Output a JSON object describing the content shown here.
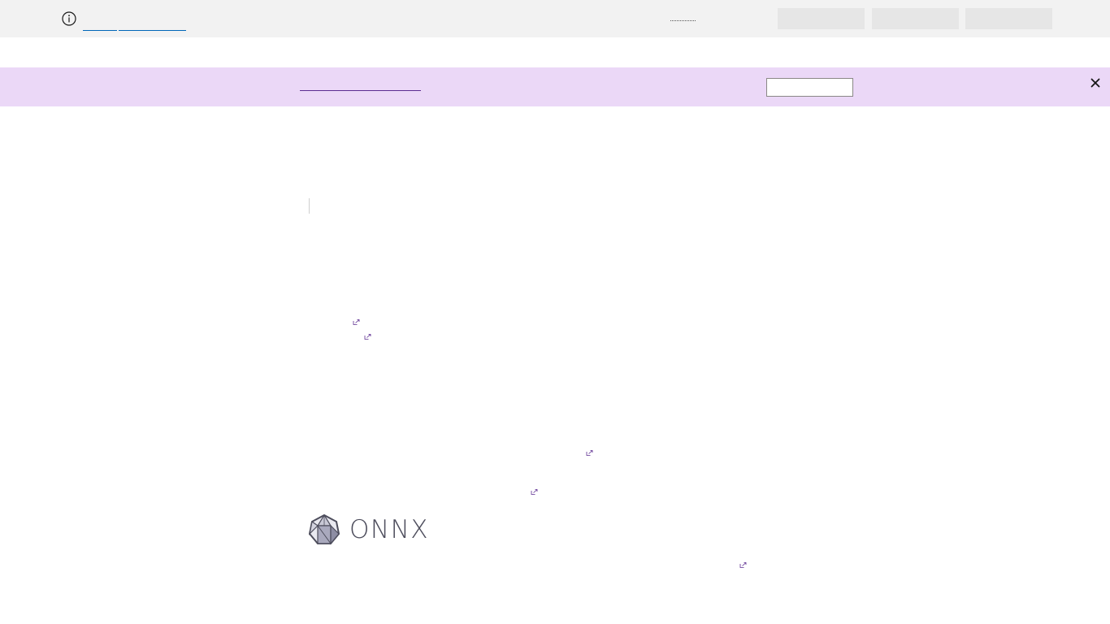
{
  "icons": {
    "info": "info-icon",
    "close": "close-icon",
    "external": "external-link-icon",
    "logo": "onnx-logo-mark"
  },
  "logo": {
    "text": "ONNX"
  },
  "colors": {
    "topbar_bg": "#f2f2f2",
    "banner_bg": "#ebd8f7",
    "link": "#0067b8",
    "logo_text": "#4d4d5c"
  }
}
